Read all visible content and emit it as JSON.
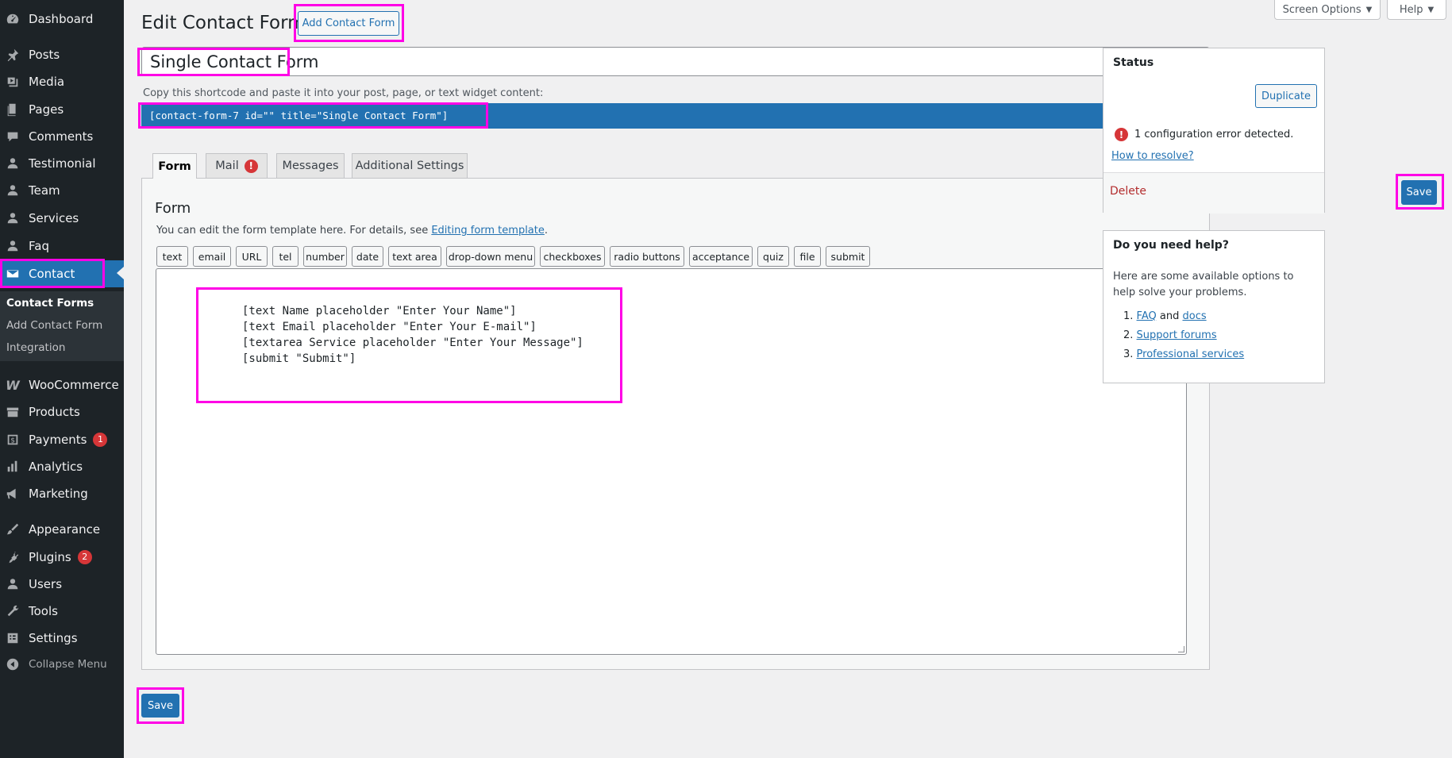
{
  "sidebar": {
    "items": [
      {
        "label": "Dashboard",
        "icon": "dashboard-icon"
      },
      {
        "label": "Posts",
        "icon": "pin-icon"
      },
      {
        "label": "Media",
        "icon": "media-icon"
      },
      {
        "label": "Pages",
        "icon": "pages-icon"
      },
      {
        "label": "Comments",
        "icon": "comment-icon"
      },
      {
        "label": "Testimonial",
        "icon": "user-icon"
      },
      {
        "label": "Team",
        "icon": "user-icon"
      },
      {
        "label": "Services",
        "icon": "user-icon"
      },
      {
        "label": "Faq",
        "icon": "user-icon"
      },
      {
        "label": "Contact",
        "icon": "envelope-icon"
      },
      {
        "label": "WooCommerce",
        "icon": "woocommerce-icon"
      },
      {
        "label": "Products",
        "icon": "archive-icon"
      },
      {
        "label": "Payments",
        "icon": "payments-icon",
        "badge": "1"
      },
      {
        "label": "Analytics",
        "icon": "chart-icon"
      },
      {
        "label": "Marketing",
        "icon": "megaphone-icon"
      },
      {
        "label": "Appearance",
        "icon": "brush-icon"
      },
      {
        "label": "Plugins",
        "icon": "plug-icon",
        "badge": "2"
      },
      {
        "label": "Users",
        "icon": "user-icon"
      },
      {
        "label": "Tools",
        "icon": "wrench-icon"
      },
      {
        "label": "Settings",
        "icon": "settings-icon"
      },
      {
        "label": "Collapse Menu",
        "icon": "collapse-icon"
      }
    ],
    "submenu": [
      "Contact Forms",
      "Add Contact Form",
      "Integration"
    ]
  },
  "header": {
    "title": "Edit Contact Form",
    "add_button": "Add Contact Form",
    "screen_options": "Screen Options",
    "help": "Help"
  },
  "form": {
    "title_value": "Single Contact Form",
    "shortcode_label": "Copy this shortcode and paste it into your post, page, or text widget content:",
    "shortcode": "[contact-form-7 id=\"\" title=\"Single Contact Form\"]"
  },
  "tabs": [
    {
      "label": "Form"
    },
    {
      "label": "Mail",
      "alert": "!"
    },
    {
      "label": "Messages"
    },
    {
      "label": "Additional Settings"
    }
  ],
  "panel": {
    "heading": "Form",
    "desc_prefix": "You can edit the form template here. For details, see ",
    "desc_link": "Editing form template",
    "desc_suffix": ".",
    "tags": [
      "text",
      "email",
      "URL",
      "tel",
      "number",
      "date",
      "text area",
      "drop-down menu",
      "checkboxes",
      "radio buttons",
      "acceptance",
      "quiz",
      "file",
      "submit"
    ],
    "template_lines": [
      "[text Name placeholder \"Enter Your Name\"]",
      "[text Email placeholder \"Enter Your E-mail\"]",
      "[textarea Service placeholder \"Enter Your Message\"]",
      "[submit \"Submit\"]"
    ]
  },
  "save_bottom": "Save",
  "status_box": {
    "title": "Status",
    "duplicate": "Duplicate",
    "error_text": "1 configuration error detected.",
    "resolve_link": "How to resolve?",
    "delete": "Delete",
    "save": "Save"
  },
  "help_box": {
    "title": "Do you need help?",
    "text": "Here are some available options to help solve your problems.",
    "items": [
      {
        "num": "1.",
        "link1": "FAQ",
        "and": "and",
        "link2": "docs"
      },
      {
        "num": "2.",
        "link1": "Support forums"
      },
      {
        "num": "3.",
        "link1": "Professional services"
      }
    ]
  },
  "colors": {
    "accent": "#2271b1",
    "highlight": "#ff00e6",
    "error": "#d63638",
    "sidebar": "#1d2327"
  }
}
